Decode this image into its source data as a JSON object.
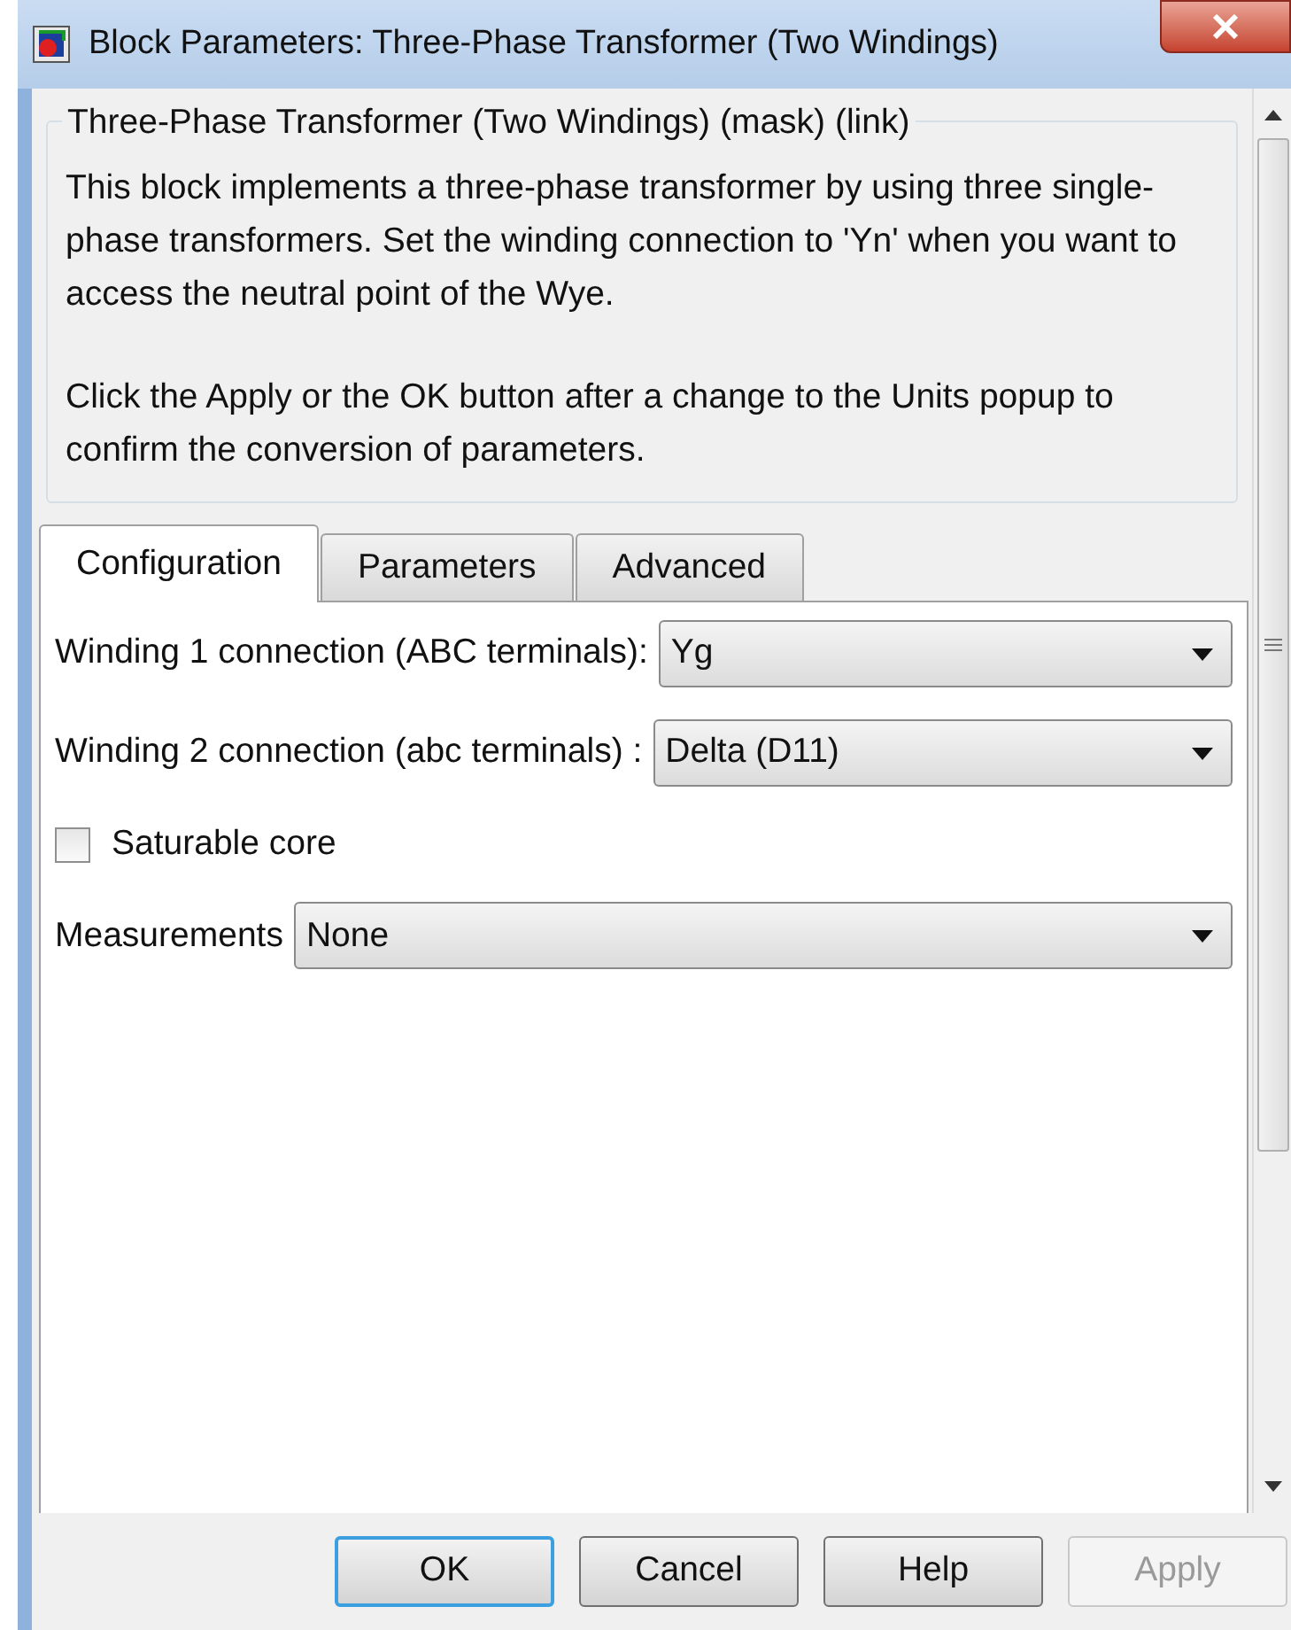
{
  "window": {
    "title": "Block Parameters: Three-Phase Transformer (Two Windings)"
  },
  "group": {
    "title": "Three-Phase Transformer (Two Windings) (mask) (link)",
    "paragraphs": [
      "This block implements a three-phase transformer by using three single-phase transformers. Set the winding connection to 'Yn' when you want to access the neutral point of the Wye.",
      "Click the Apply or the OK button after a change to the Units popup to confirm the conversion of parameters."
    ]
  },
  "tabs": [
    {
      "label": "Configuration",
      "selected": true
    },
    {
      "label": "Parameters",
      "selected": false
    },
    {
      "label": "Advanced",
      "selected": false
    }
  ],
  "fields": [
    {
      "kind": "dropdown",
      "label": "Winding 1 connection (ABC terminals):",
      "value": "Yg"
    },
    {
      "kind": "dropdown",
      "label": "Winding 2 connection (abc terminals) :",
      "value": "Delta (D11)"
    },
    {
      "kind": "checkbox",
      "label": "Saturable core",
      "checked": false
    },
    {
      "kind": "dropdown",
      "label": "Measurements",
      "value": "None"
    }
  ],
  "buttons": [
    {
      "label": "OK",
      "default": true,
      "disabled": false
    },
    {
      "label": "Cancel",
      "default": false,
      "disabled": false
    },
    {
      "label": "Help",
      "default": false,
      "disabled": false
    },
    {
      "label": "Apply",
      "default": false,
      "disabled": true
    }
  ]
}
